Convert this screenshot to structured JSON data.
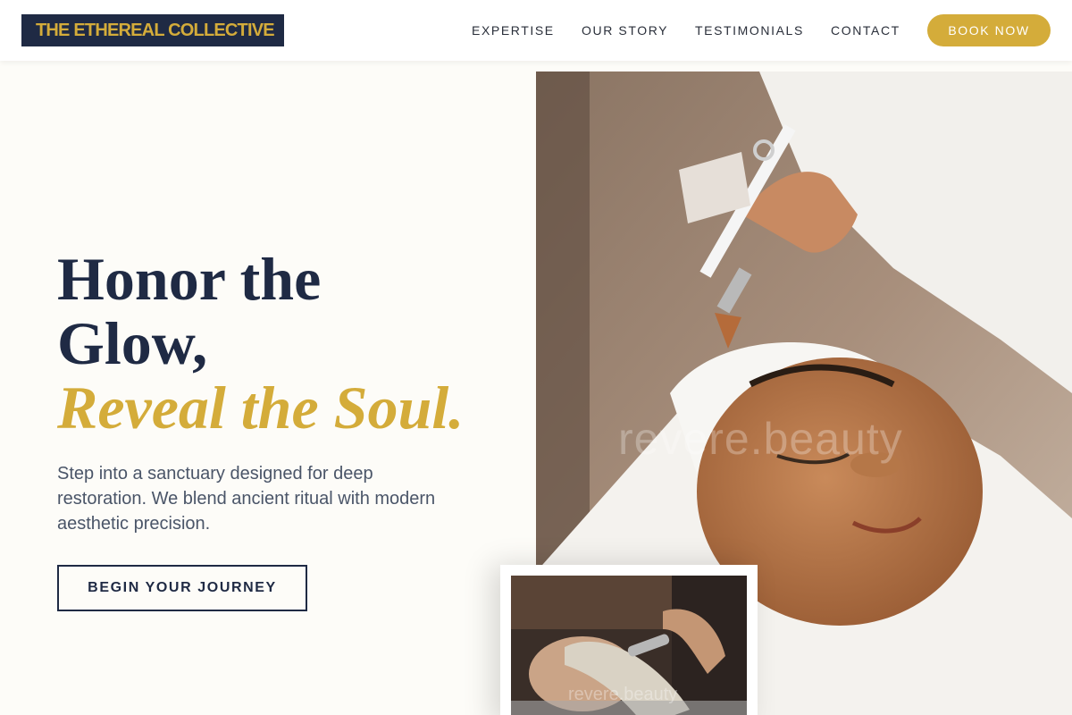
{
  "brand": {
    "name": "THE ETHEREAL COLLECTIVE"
  },
  "nav": {
    "items": [
      {
        "label": "EXPERTISE"
      },
      {
        "label": "OUR STORY"
      },
      {
        "label": "TESTIMONIALS"
      },
      {
        "label": "CONTACT"
      }
    ],
    "cta_label": "BOOK NOW"
  },
  "hero": {
    "title_line1": "Honor the",
    "title_line2": "Glow,",
    "title_accent": "Reveal the Soul.",
    "description": "Step into a sanctuary designed for deep restoration. We blend ancient ritual with modern aesthetic precision.",
    "cta_label": "BEGIN YOUR JOURNEY"
  },
  "images": {
    "main_watermark": "revere.beauty",
    "inset_watermark": "revere.beauty"
  },
  "colors": {
    "navy": "#1f2a44",
    "gold": "#d4ac3a",
    "cream": "#fdfcf8"
  }
}
